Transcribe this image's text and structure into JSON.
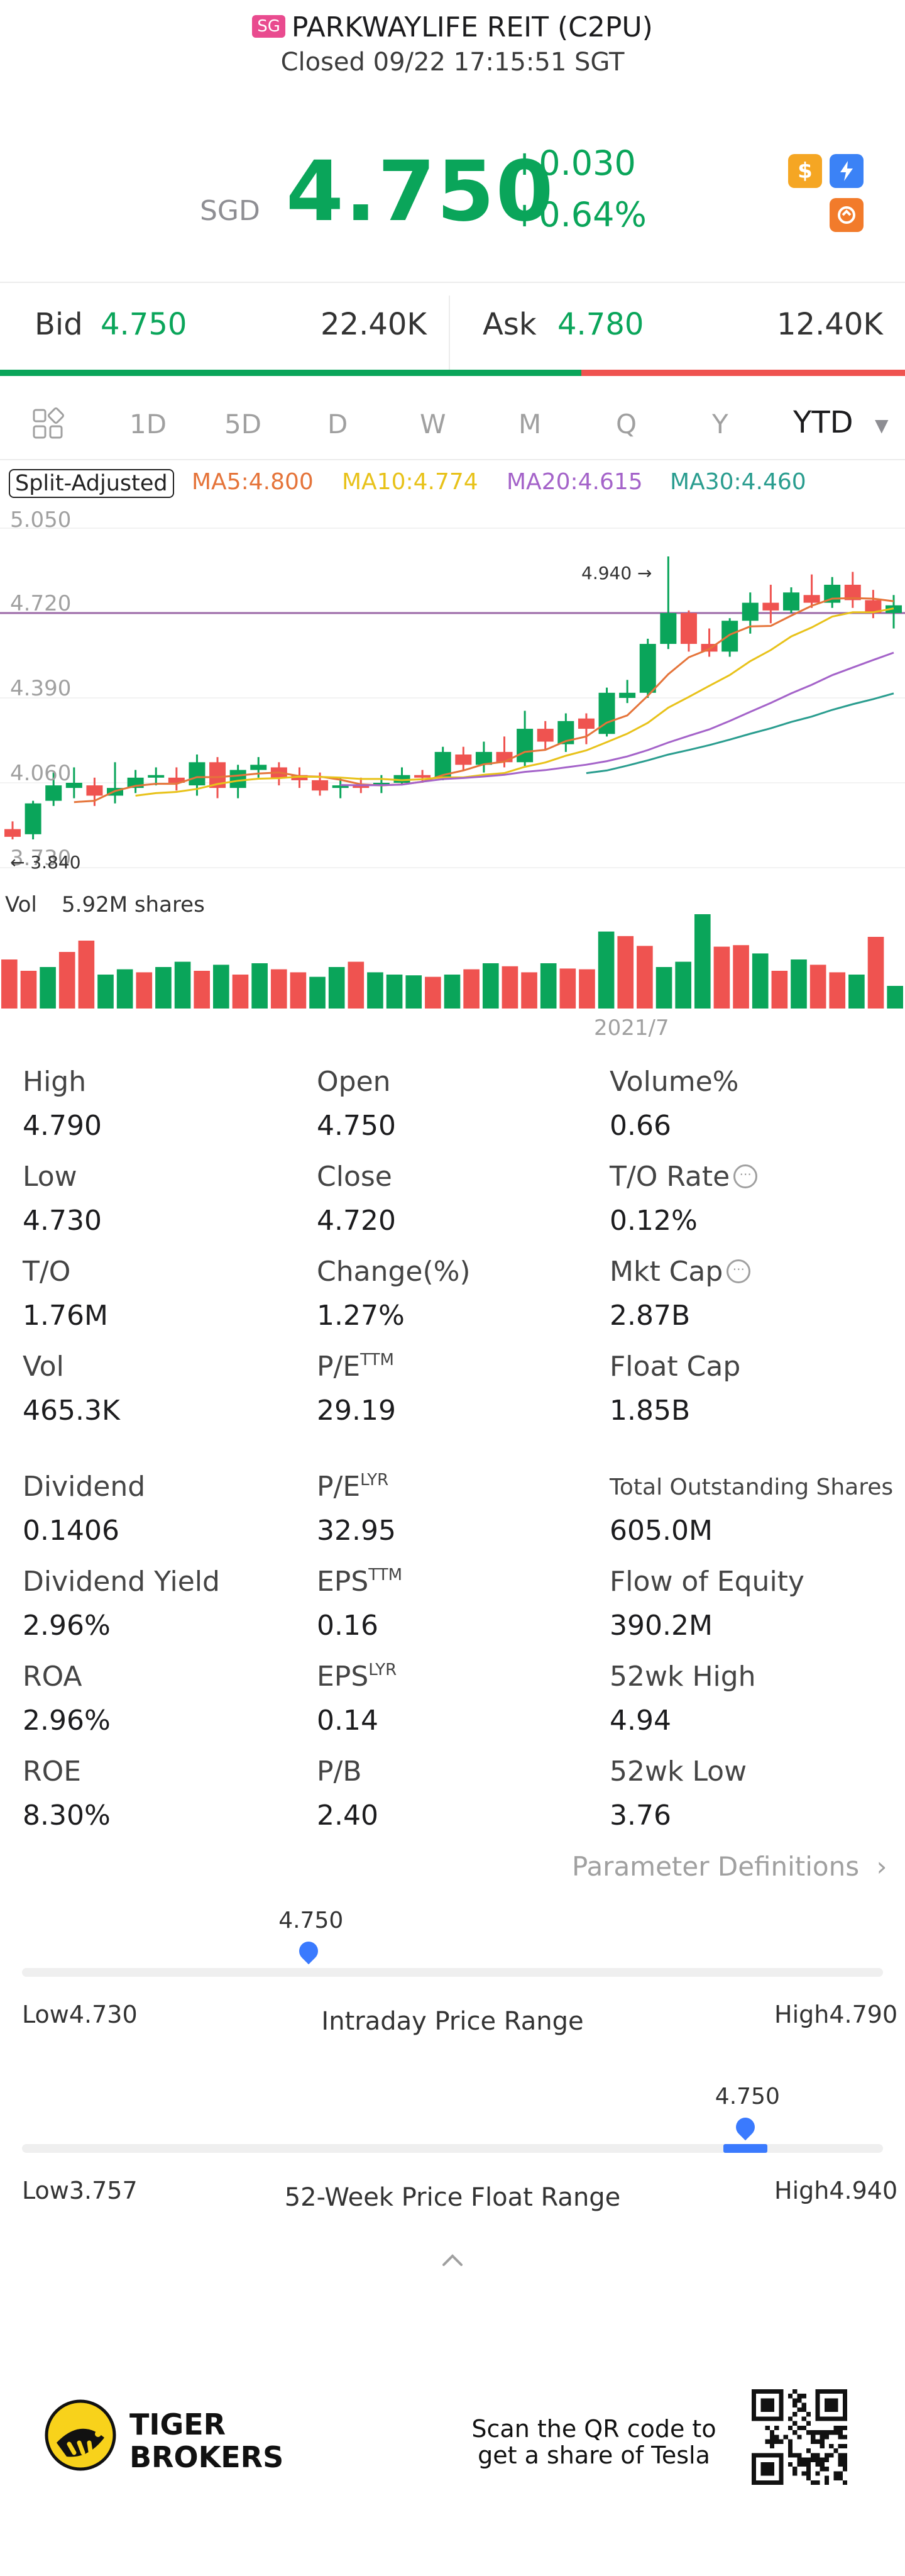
{
  "header": {
    "market_badge": "SG",
    "title": "PARKWAYLIFE REIT (C2PU)",
    "status": "Closed 09/22 17:15:51 SGT"
  },
  "quote": {
    "currency": "SGD",
    "price": "4.750",
    "change": "+0.030",
    "change_pct": "+0.64%",
    "icons": [
      "dollar-icon",
      "flash-icon",
      "swap-icon"
    ]
  },
  "bid_ask": {
    "bid_label": "Bid",
    "bid_price": "4.750",
    "bid_size": "22.40K",
    "ask_label": "Ask",
    "ask_price": "4.780",
    "ask_size": "12.40K",
    "bid_ratio": 0.643
  },
  "tabs": {
    "items": [
      "1D",
      "5D",
      "D",
      "W",
      "M",
      "Q",
      "Y",
      "YTD"
    ],
    "active": "YTD"
  },
  "ma_legend": {
    "split_label": "Split-Adjusted",
    "ma5": "MA5:4.800",
    "ma10": "MA10:4.774",
    "ma20": "MA20:4.615",
    "ma30": "MA30:4.460"
  },
  "chart": {
    "y_ticks": [
      "5.050",
      "4.720",
      "4.390",
      "4.060",
      "3.730"
    ],
    "high_marker": "4.940",
    "low_marker": "3.840",
    "vol_label": "Vol",
    "vol_value": "5.92M shares",
    "x_label": "2021/7",
    "colors": {
      "up": "#0aa55a",
      "down": "#ef5350",
      "ma5": "#e5743a",
      "ma10": "#e8c21a",
      "ma20": "#a463c9",
      "ma30": "#2a9d8f",
      "ref": "#9c6aa8"
    }
  },
  "chart_data": {
    "type": "candlestick",
    "ylim": [
      3.73,
      5.05
    ],
    "candles": [
      [
        3.88,
        3.85,
        3.91,
        3.84
      ],
      [
        3.86,
        3.98,
        3.99,
        3.84
      ],
      [
        3.99,
        4.05,
        4.1,
        3.97
      ],
      [
        4.04,
        4.06,
        4.12,
        4.0
      ],
      [
        4.05,
        4.01,
        4.08,
        3.97
      ],
      [
        4.01,
        4.04,
        4.14,
        3.98
      ],
      [
        4.04,
        4.08,
        4.11,
        4.02
      ],
      [
        4.08,
        4.09,
        4.12,
        4.05
      ],
      [
        4.08,
        4.06,
        4.12,
        4.03
      ],
      [
        4.05,
        4.14,
        4.17,
        4.01
      ],
      [
        4.14,
        4.04,
        4.16,
        4.0
      ],
      [
        4.04,
        4.11,
        4.13,
        4.0
      ],
      [
        4.11,
        4.13,
        4.16,
        4.08
      ],
      [
        4.12,
        4.08,
        4.14,
        4.05
      ],
      [
        4.09,
        4.07,
        4.12,
        4.04
      ],
      [
        4.07,
        4.03,
        4.1,
        4.01
      ],
      [
        4.04,
        4.05,
        4.08,
        4.0
      ],
      [
        4.05,
        4.04,
        4.08,
        4.02
      ],
      [
        4.05,
        4.06,
        4.09,
        4.02
      ],
      [
        4.06,
        4.09,
        4.12,
        4.05
      ],
      [
        4.09,
        4.08,
        4.11,
        4.06
      ],
      [
        4.08,
        4.18,
        4.2,
        4.07
      ],
      [
        4.17,
        4.13,
        4.2,
        4.11
      ],
      [
        4.13,
        4.18,
        4.22,
        4.1
      ],
      [
        4.18,
        4.14,
        4.24,
        4.12
      ],
      [
        4.14,
        4.27,
        4.34,
        4.12
      ],
      [
        4.27,
        4.22,
        4.3,
        4.19
      ],
      [
        4.21,
        4.3,
        4.33,
        4.18
      ],
      [
        4.31,
        4.27,
        4.33,
        4.21
      ],
      [
        4.25,
        4.41,
        4.43,
        4.24
      ],
      [
        4.39,
        4.41,
        4.46,
        4.37
      ],
      [
        4.41,
        4.6,
        4.62,
        4.39
      ],
      [
        4.6,
        4.72,
        4.94,
        4.58
      ],
      [
        4.72,
        4.6,
        4.73,
        4.57
      ],
      [
        4.6,
        4.57,
        4.66,
        4.55
      ],
      [
        4.57,
        4.69,
        4.7,
        4.55
      ],
      [
        4.69,
        4.76,
        4.8,
        4.64
      ],
      [
        4.76,
        4.73,
        4.83,
        4.68
      ],
      [
        4.73,
        4.8,
        4.82,
        4.72
      ],
      [
        4.79,
        4.76,
        4.87,
        4.74
      ],
      [
        4.76,
        4.83,
        4.86,
        4.74
      ],
      [
        4.83,
        4.77,
        4.88,
        4.74
      ],
      [
        4.77,
        4.72,
        4.81,
        4.7
      ],
      [
        4.72,
        4.75,
        4.79,
        4.66
      ]
    ],
    "volume": [
      65,
      50,
      55,
      75,
      90,
      45,
      52,
      48,
      55,
      62,
      50,
      58,
      45,
      60,
      52,
      48,
      42,
      55,
      62,
      48,
      45,
      44,
      42,
      45,
      52,
      60,
      56,
      48,
      60,
      53,
      52,
      102,
      96,
      83,
      55,
      62,
      125,
      82,
      84,
      73,
      50,
      65,
      58,
      48,
      45,
      95,
      30
    ],
    "vol_colors": [
      "d",
      "d",
      "u",
      "d",
      "d",
      "u",
      "u",
      "d",
      "u",
      "u",
      "d",
      "u",
      "d",
      "u",
      "d",
      "d",
      "u",
      "u",
      "d",
      "u",
      "u",
      "u",
      "d",
      "u",
      "d",
      "u",
      "d",
      "d",
      "u",
      "d",
      "d",
      "u",
      "d",
      "d",
      "u",
      "u",
      "u",
      "d",
      "d",
      "u",
      "d",
      "u",
      "d",
      "d",
      "u",
      "d",
      "u"
    ]
  },
  "stats": {
    "cells": [
      {
        "label": "High",
        "value": "4.790"
      },
      {
        "label": "Open",
        "value": "4.750"
      },
      {
        "label": "Volume%",
        "value": "0.66"
      },
      {
        "label": "Low",
        "value": "4.730"
      },
      {
        "label": "Close",
        "value": "4.720"
      },
      {
        "label": "T/O Rate",
        "value": "0.12%"
      },
      {
        "label": "T/O",
        "value": "1.76M"
      },
      {
        "label": "Change(%)",
        "value": "1.27%"
      },
      {
        "label": "Mkt Cap",
        "value": "2.87B"
      },
      {
        "label": "Vol",
        "value": "465.3K"
      },
      {
        "label": "P/E",
        "sup": "TTM",
        "value": "29.19"
      },
      {
        "label": "Float Cap",
        "value": "1.85B"
      },
      {
        "label": "Dividend",
        "value": "0.1406"
      },
      {
        "label": "P/E",
        "sup": "LYR",
        "value": "32.95"
      },
      {
        "label": "Total Outstanding Shares",
        "value": "605.0M"
      },
      {
        "label": "Dividend Yield",
        "value": "2.96%"
      },
      {
        "label": "EPS",
        "sup": "TTM",
        "value": "0.16"
      },
      {
        "label": "Flow of Equity",
        "value": "390.2M"
      },
      {
        "label": "ROA",
        "value": "2.96%"
      },
      {
        "label": "EPS",
        "sup": "LYR",
        "value": "0.14"
      },
      {
        "label": "52wk High",
        "value": "4.94"
      },
      {
        "label": "ROE",
        "value": "8.30%"
      },
      {
        "label": "P/B",
        "value": "2.40"
      },
      {
        "label": "52wk Low",
        "value": "3.76"
      }
    ],
    "param_link": "Parameter Definitions"
  },
  "intraday_range": {
    "title": "Intraday Price Range",
    "low_label": "Low",
    "low": "4.730",
    "high_label": "High",
    "high": "4.790",
    "current": "4.750",
    "position": 0.333
  },
  "week52_range": {
    "title": "52-Week Price Float Range",
    "low_label": "Low",
    "low": "3.757",
    "high_label": "High",
    "high": "4.940",
    "current": "4.750",
    "position": 0.84
  },
  "footer": {
    "brand_line1": "TIGER",
    "brand_line2": "BROKERS",
    "qr_text": "Scan the QR code to get a share of Tesla"
  }
}
